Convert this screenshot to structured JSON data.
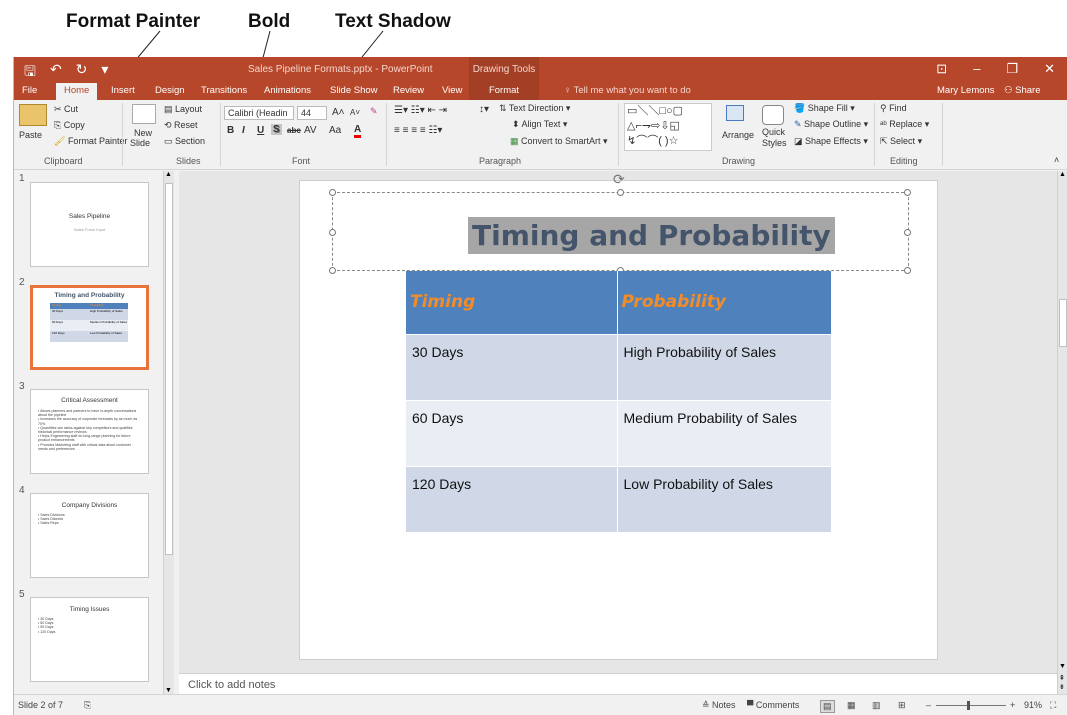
{
  "callouts": {
    "format_painter": "Format Painter",
    "bold": "Bold",
    "text_shadow": "Text Shadow"
  },
  "titlebar": {
    "title": "Sales Pipeline Formats.pptx - PowerPoint",
    "context_group": "Drawing Tools",
    "accent_color": "#b7472a"
  },
  "tabs": [
    "File",
    "Home",
    "Insert",
    "Design",
    "Transitions",
    "Animations",
    "Slide Show",
    "Review",
    "View",
    "Format"
  ],
  "active_tab": "Home",
  "tell_me": "Tell me what you want to do",
  "user": "Mary Lemons",
  "share": "Share",
  "ribbon": {
    "clipboard": {
      "paste": "Paste",
      "cut": "Cut",
      "copy": "Copy",
      "format_painter": "Format Painter",
      "label": "Clipboard"
    },
    "slides": {
      "new_slide_line1": "New",
      "new_slide_line2": "Slide",
      "layout": "Layout",
      "reset": "Reset",
      "section": "Section",
      "label": "Slides"
    },
    "font": {
      "font_name": "Calibri (Headin",
      "font_size": "44",
      "bold": "B",
      "italic": "I",
      "underline": "U",
      "shadow": "S",
      "strike": "abc",
      "spacing": "AV",
      "case": "Aa",
      "color": "A",
      "label": "Font"
    },
    "paragraph": {
      "text_direction": "Text Direction",
      "align_text": "Align Text",
      "convert_smartart": "Convert to SmartArt",
      "label": "Paragraph"
    },
    "drawing": {
      "arrange": "Arrange",
      "quick_styles_1": "Quick",
      "quick_styles_2": "Styles",
      "shape_fill": "Shape Fill",
      "shape_outline": "Shape Outline",
      "shape_effects": "Shape Effects",
      "label": "Drawing"
    },
    "editing": {
      "find": "Find",
      "replace": "Replace",
      "select": "Select",
      "label": "Editing"
    }
  },
  "thumbnails": [
    {
      "num": "1",
      "title": "Sales Pipeline",
      "sub": "Sales Force Input"
    },
    {
      "num": "2",
      "title": "Timing and Probability",
      "rows": [
        [
          "Timing",
          "Probability"
        ],
        [
          "30 Days",
          "High Probability of Sales"
        ],
        [
          "60 Days",
          "Medium Probability of Sales"
        ],
        [
          "120 Days",
          "Low Probability of Sales"
        ]
      ]
    },
    {
      "num": "3",
      "title": "Critical Assessment",
      "bullets": [
        "Allows planners and partners to have in-depth conversations about the pipeline",
        "Increases the accuracy of corporate forecasts by as much as 70%",
        "Quantifies win ratios against key competitors and qualifies historical performance reviews",
        "Helps Engineering staff do long-range planning for future product enhancements",
        "Provides Marketing staff with critical data about customer needs and preferences"
      ]
    },
    {
      "num": "4",
      "title": "Company Divisions",
      "bullets": [
        "Sales Divisions",
        "Sales Districts",
        "Sales Reps"
      ]
    },
    {
      "num": "5",
      "title": "Timing Issues",
      "bullets": [
        "30 Days",
        "60 Days",
        "90 Days",
        "120 Days"
      ]
    }
  ],
  "slide": {
    "title": "Timing and Probability",
    "table": {
      "headers": [
        "Timing",
        "Probability"
      ],
      "rows": [
        [
          "30 Days",
          "High Probability of Sales"
        ],
        [
          "60 Days",
          "Medium Probability of Sales"
        ],
        [
          "120 Days",
          "Low Probability of Sales"
        ]
      ]
    }
  },
  "notes_placeholder": "Click to add notes",
  "status": {
    "slide_info": "Slide 2 of 7",
    "notes": "Notes",
    "comments": "Comments",
    "zoom": "91%"
  }
}
